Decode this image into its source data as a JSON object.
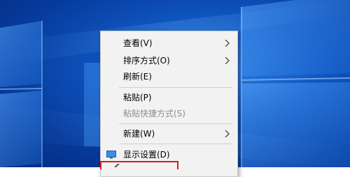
{
  "desktop": {
    "background": "#0b4fb8",
    "accent_light": "#6fb6ff"
  },
  "context_menu": {
    "items": [
      {
        "label": "查看(V)",
        "submenu": true,
        "disabled": false
      },
      {
        "label": "排序方式(O)",
        "submenu": true,
        "disabled": false
      },
      {
        "label": "刷新(E)",
        "submenu": false,
        "disabled": false
      },
      {
        "label": "粘贴(P)",
        "submenu": false,
        "disabled": false
      },
      {
        "label": "粘贴快捷方式(S)",
        "submenu": false,
        "disabled": true
      },
      {
        "label": "新建(W)",
        "submenu": true,
        "disabled": false
      },
      {
        "label": "显示设置(D)",
        "submenu": false,
        "disabled": false,
        "icon": "display-settings-icon"
      }
    ]
  },
  "annotation": {
    "color": "#e21818"
  }
}
